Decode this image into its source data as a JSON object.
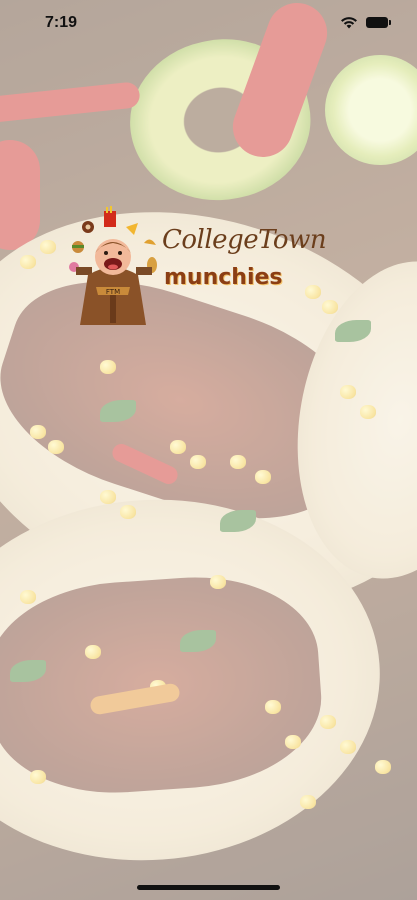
{
  "status_bar": {
    "time": "7:19"
  },
  "logo": {
    "line1": "CollegeTown",
    "line2": "munchies",
    "badge_text": "FTM"
  },
  "icons": [
    "wifi-icon",
    "battery-icon",
    "monk-mascot-icon"
  ]
}
